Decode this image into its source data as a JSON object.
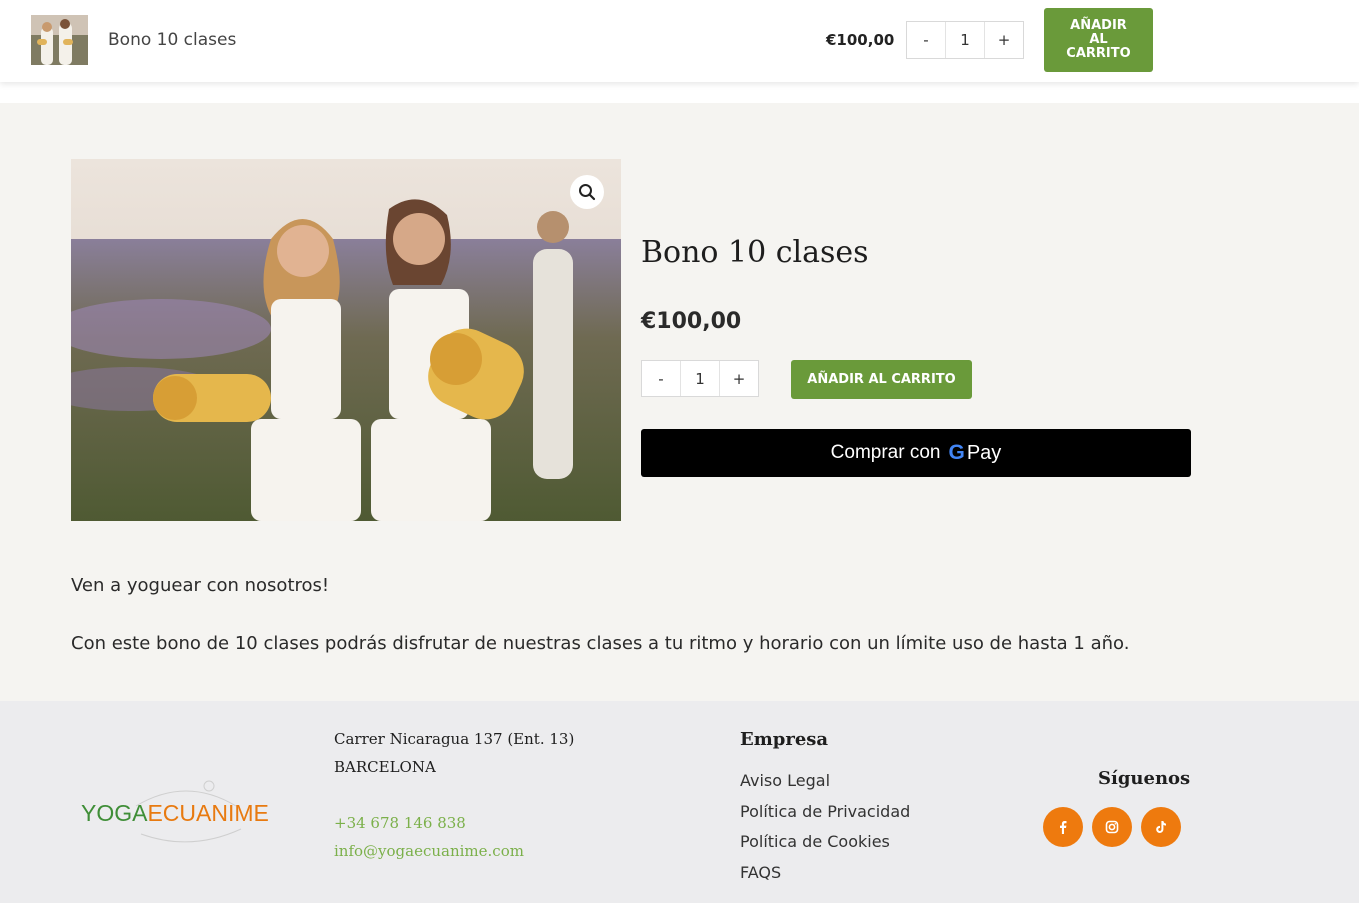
{
  "sticky_bar": {
    "title": "Bono 10 clases",
    "price": "€100,00",
    "qty_minus": "-",
    "qty_value": "1",
    "qty_plus": "+",
    "add_to_cart": "AÑADIR AL CARRITO"
  },
  "product": {
    "title": "Bono 10 clases",
    "price": "€100,00",
    "qty_minus": "-",
    "qty_value": "1",
    "qty_plus": "+",
    "add_to_cart": "AÑADIR AL CARRITO",
    "gpay_label": "Comprar con",
    "gpay_g": "G",
    "gpay_pay": "Pay",
    "image_zoom_icon": "magnifier-icon"
  },
  "description": {
    "line1": "Ven a yoguear con nosotros!",
    "line2": "Con este bono de 10 clases podrás disfrutar de nuestras clases a tu ritmo y horario con un límite uso de hasta 1 año."
  },
  "footer": {
    "logo_part1": "YOGA",
    "logo_part2": "ECUANIME",
    "address_line1": "Carrer Nicaragua 137 (Ent. 13)",
    "address_line2": "BARCELONA",
    "phone": "+34 678 146 838",
    "email": "info@yogaecuanime.com",
    "company_title": "Empresa",
    "links": [
      "Aviso Legal",
      "Política de Privacidad",
      "Política de Cookies",
      "FAQS"
    ],
    "follow_title": "Síguenos",
    "social_icons": [
      "facebook-icon",
      "instagram-icon",
      "tiktok-icon"
    ]
  },
  "colors": {
    "accent_green": "#6a9a3a",
    "social_orange": "#ee7a0e",
    "link_green": "#7bb04a",
    "logo_green": "#3f8e37",
    "logo_orange": "#e87a10"
  }
}
